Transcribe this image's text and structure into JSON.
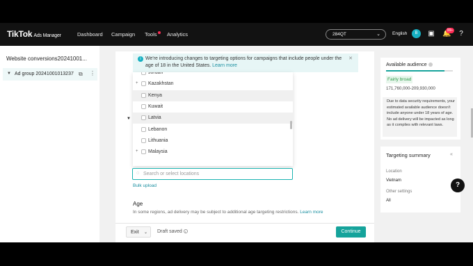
{
  "brand": {
    "logo": "TikTok",
    "sub": "Ads Manager"
  },
  "nav": {
    "dashboard": "Dashboard",
    "campaign": "Campaign",
    "tools": "Tools",
    "analytics": "Analytics"
  },
  "account": {
    "name": "284QT",
    "language": "English",
    "avatar": "B",
    "notifications": "99+"
  },
  "left": {
    "campaign": "Website conversions20241001...",
    "adgroup": "Ad group 20241001013237"
  },
  "notice": {
    "text": "We're introducing changes to targeting options for campaigns that include people under the age of 18 in the United States.",
    "link": "Learn more"
  },
  "locations": [
    {
      "name": "Jordan",
      "expand": "",
      "highlight": false
    },
    {
      "name": "Kazakhstan",
      "expand": "+",
      "highlight": false
    },
    {
      "name": "Kenya",
      "expand": "",
      "highlight": true
    },
    {
      "name": "Kuwait",
      "expand": "",
      "highlight": false
    },
    {
      "name": "Latvia",
      "expand": "",
      "highlight": true
    },
    {
      "name": "Lebanon",
      "expand": "",
      "highlight": false
    },
    {
      "name": "Lithuania",
      "expand": "",
      "highlight": false
    },
    {
      "name": "Malaysia",
      "expand": "+",
      "highlight": false
    }
  ],
  "search": {
    "placeholder": "Search or select locations"
  },
  "bulk_upload": "Bulk upload",
  "age": {
    "title": "Age",
    "note": "In some regions, ad delivery may be subject to additional age targeting restrictions.",
    "link": "Learn more"
  },
  "footer": {
    "exit": "Exit",
    "draft": "Draft saved",
    "continue": "Continue"
  },
  "audience": {
    "title": "Available audience",
    "state": "Fairly broad",
    "range": "171,760,000-209,930,000",
    "level": 0.88,
    "note": "Due to data security requirements, your estimated available audience doesn't include anyone under 18 years of age. No ad delivery will be impacted as long as it complies with relevant laws."
  },
  "summary": {
    "title": "Targeting summary",
    "location_label": "Location",
    "location_value": "Vietnam",
    "other_label": "Other settings",
    "other_value": "All"
  },
  "colors": {
    "accent": "#15a39b",
    "link": "#1a8fa0",
    "alert": "#fe2c55"
  }
}
